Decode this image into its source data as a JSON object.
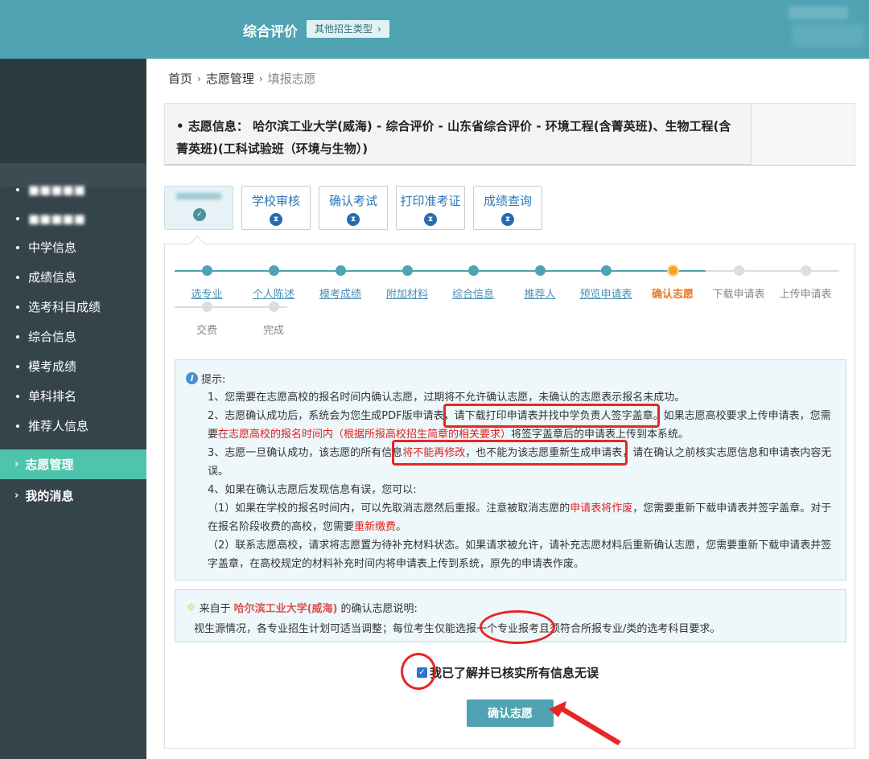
{
  "header": {
    "title": "综合评价",
    "type_button": "其他招生类型"
  },
  "sidebar": {
    "items": [
      {
        "label": "■■■■■",
        "blurred": true
      },
      {
        "label": "■■■■■",
        "blurred": true
      },
      {
        "label": "中学信息"
      },
      {
        "label": "成绩信息"
      },
      {
        "label": "选考科目成绩"
      },
      {
        "label": "综合信息"
      },
      {
        "label": "模考成绩"
      },
      {
        "label": "单科排名"
      },
      {
        "label": "推荐人信息"
      }
    ],
    "groups": [
      {
        "label": "志愿管理",
        "active": true
      },
      {
        "label": "我的消息"
      }
    ]
  },
  "breadcrumb": {
    "home": "首页",
    "section": "志愿管理",
    "current": "填报志愿"
  },
  "application": {
    "label": "志愿信息：",
    "detail": "哈尔滨工业大学(威海) - 综合评价 - 山东省综合评价 - 环境工程(含菁英班)、生物工程(含菁英班)(工科试验班（环境与生物）)"
  },
  "step_tabs": [
    {
      "label": "学校审核"
    },
    {
      "label": "确认考试"
    },
    {
      "label": "打印准考证"
    },
    {
      "label": "成绩查询"
    }
  ],
  "progress": {
    "steps": [
      {
        "label": "选专业",
        "state": "done"
      },
      {
        "label": "个人陈述",
        "state": "done"
      },
      {
        "label": "模考成绩",
        "state": "done"
      },
      {
        "label": "附加材料",
        "state": "done"
      },
      {
        "label": "综合信息",
        "state": "done"
      },
      {
        "label": "推荐人",
        "state": "done"
      },
      {
        "label": "预览申请表",
        "state": "done"
      },
      {
        "label": "确认志愿",
        "state": "current"
      },
      {
        "label": "下载申请表",
        "state": "todo"
      },
      {
        "label": "上传申请表",
        "state": "todo"
      },
      {
        "label": "交费",
        "state": "todo"
      },
      {
        "label": "完成",
        "state": "todo"
      }
    ]
  },
  "tips": {
    "heading": "提示:",
    "p1": "1、您需要在志愿高校的报名时间内确认志愿，过期将不允许确认志愿，未确认的志愿表示报名未成功。",
    "p2a": "2、志愿确认成功后，系统会为您生成PDF版申请表，",
    "p2b": "请下载打印申请表并找中学负责人签字盖章。",
    "p2c": "如果志愿高校要求上传申请表，您需要",
    "p2d": "在志愿高校的报名时间内（根据所报高校招生简章的相关要求）",
    "p2e": "将签字盖章后的申请表上传到本系统。",
    "p3a": "3、志愿一旦确认成功，该志愿的所有信息",
    "p3b": "将不能再修改",
    "p3c": "，也不能为该志愿重新生成申请表，",
    "p3d": "请在确认之前核实志愿信息和申请表内容无误。",
    "p4": "4、如果在确认志愿后发现信息有误，您可以:",
    "p5a": "（1）如果在学校的报名时间内，可以先取消志愿然后重报。注意被取消志愿的",
    "p5b": "申请表将作废",
    "p5c": "，您需要重新下载申请表并签字盖章。对于在报名阶段收费的高校，您需要",
    "p5d": "重新缴费",
    "p5e": "。",
    "p6": "（2）联系志愿高校，请求将志愿置为待补充材料状态。如果请求被允许，请补充志愿材料后重新确认志愿，您需要重新下载申请表并签字盖章，在高校规定的材料补充时间内将申请表上传到系统，原先的申请表作废。"
  },
  "school_note": {
    "prefix": "来自于",
    "school": "哈尔滨工业大学(威海)",
    "suffix": "的确认志愿说明:",
    "body": "视生源情况，各专业招生计划可适当调整；每位考生仅能选报一个专业报考且须符合所报专业/类的选考科目要求。"
  },
  "agree": {
    "label": "我已了解并已核实所有信息无误",
    "checked": true
  },
  "confirm_button": "确认志愿",
  "colors": {
    "primary": "#4fa3b3",
    "sidebar": "#35434b",
    "active": "#4ec4ac",
    "current_step": "#e87722",
    "warning": "#e02020",
    "annotation": "#e82525"
  }
}
